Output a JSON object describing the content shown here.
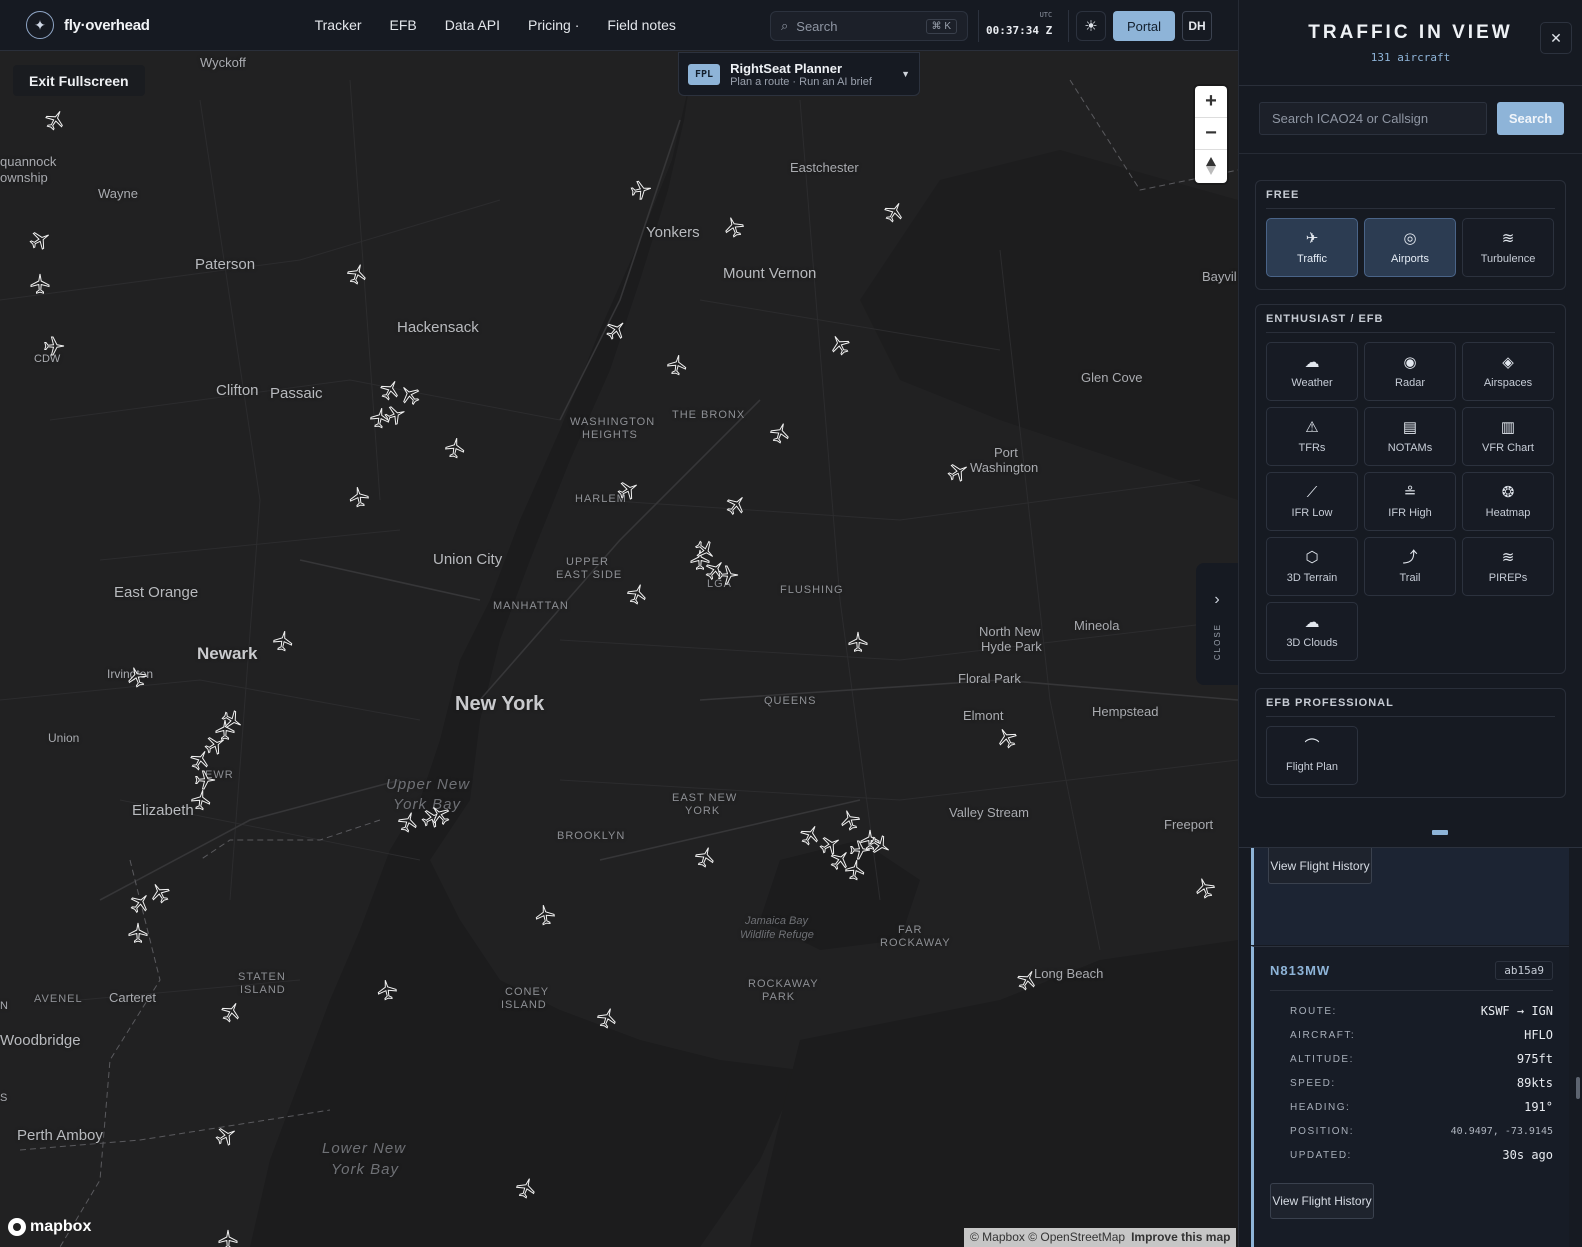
{
  "app": {
    "logo_text": "fly·overhead",
    "nav": [
      "Tracker",
      "EFB",
      "Data API",
      "Pricing ·",
      "Field notes"
    ],
    "search_placeholder": "Search",
    "search_shortcut": "⌘ K",
    "utc_label": "UTC",
    "clock": "00:37:34 Z",
    "portal_label": "Portal",
    "user_initials": "DH"
  },
  "map": {
    "exit_fullscreen": "Exit Fullscreen",
    "fpl": {
      "badge": "FPL",
      "title": "RightSeat Planner",
      "subtitle": "Plan a route · Run an AI brief"
    },
    "close_tab": "CLOSE",
    "mapbox": "mapbox",
    "attribution": "© Mapbox © OpenStreetMap",
    "improve": "Improve this map",
    "places": [
      {
        "t": "Wyckoff",
        "c": "small-plain"
      },
      {
        "t": "quannock",
        "c": "small-plain"
      },
      {
        "t": "ownship",
        "c": "small-plain"
      },
      {
        "t": "Wayne",
        "c": "small-plain"
      },
      {
        "t": "Paterson",
        "c": "mid"
      },
      {
        "t": "Hackensack",
        "c": "mid"
      },
      {
        "t": "Clifton",
        "c": "mid"
      },
      {
        "t": "Passaic",
        "c": "mid"
      },
      {
        "t": "CDW",
        "c": "small-plain"
      },
      {
        "t": "Yonkers",
        "c": "mid"
      },
      {
        "t": "Eastchester",
        "c": "small-plain"
      },
      {
        "t": "Mount Vernon",
        "c": "mid"
      },
      {
        "t": "Bayvil",
        "c": "small-plain"
      },
      {
        "t": "Glen Cove",
        "c": "small-plain"
      },
      {
        "t": "WASHINGTON",
        "c": "small"
      },
      {
        "t": "HEIGHTS",
        "c": "small"
      },
      {
        "t": "THE BRONX",
        "c": "small"
      },
      {
        "t": "Port",
        "c": "small-plain"
      },
      {
        "t": "Washington",
        "c": "small-plain"
      },
      {
        "t": "HARLEM",
        "c": "small"
      },
      {
        "t": "Union City",
        "c": "mid"
      },
      {
        "t": "UPPER",
        "c": "small"
      },
      {
        "t": "EAST SIDE",
        "c": "small"
      },
      {
        "t": "LGA",
        "c": "small"
      },
      {
        "t": "FLUSHING",
        "c": "small"
      },
      {
        "t": "East Orange",
        "c": "mid"
      },
      {
        "t": "MANHATTAN",
        "c": "small"
      },
      {
        "t": "North New",
        "c": "small-plain"
      },
      {
        "t": "Hyde Park",
        "c": "small-plain"
      },
      {
        "t": "Mineola",
        "c": "small-plain"
      },
      {
        "t": "Newark",
        "c": "big"
      },
      {
        "t": "Irvington",
        "c": "small-plain"
      },
      {
        "t": "New York",
        "c": "big"
      },
      {
        "t": "QUEENS",
        "c": "small"
      },
      {
        "t": "Floral Park",
        "c": "small-plain"
      },
      {
        "t": "Union",
        "c": "small-plain"
      },
      {
        "t": "Elmont",
        "c": "small-plain"
      },
      {
        "t": "Hempstead",
        "c": "small-plain"
      },
      {
        "t": "EWR",
        "c": "small"
      },
      {
        "t": "Upper New",
        "c": "water"
      },
      {
        "t": "York Bay",
        "c": "water"
      },
      {
        "t": "EAST NEW",
        "c": "small"
      },
      {
        "t": "YORK",
        "c": "small"
      },
      {
        "t": "Elizabeth",
        "c": "mid"
      },
      {
        "t": "BROOKLYN",
        "c": "small"
      },
      {
        "t": "Valley Stream",
        "c": "small-plain"
      },
      {
        "t": "Freeport",
        "c": "small-plain"
      },
      {
        "t": "Jamaica Bay",
        "c": "water-s"
      },
      {
        "t": "Wildlife Refuge",
        "c": "water-s"
      },
      {
        "t": "FAR",
        "c": "small"
      },
      {
        "t": "ROCKAWAY",
        "c": "small"
      },
      {
        "t": "STATEN",
        "c": "small"
      },
      {
        "t": "ISLAND",
        "c": "small"
      },
      {
        "t": "Long Beach",
        "c": "small-plain"
      },
      {
        "t": "AVENEL",
        "c": "small"
      },
      {
        "t": "Carteret",
        "c": "small-plain"
      },
      {
        "t": "ROCKAWAY",
        "c": "small"
      },
      {
        "t": "PARK",
        "c": "small"
      },
      {
        "t": "CONEY",
        "c": "small"
      },
      {
        "t": "ISLAND",
        "c": "small"
      },
      {
        "t": "Woodbridge",
        "c": "mid"
      },
      {
        "t": "Perth Amboy",
        "c": "mid"
      },
      {
        "t": "Lower New",
        "c": "water"
      },
      {
        "t": "York Bay",
        "c": "water"
      },
      {
        "t": "N",
        "c": "small-plain"
      },
      {
        "t": "S",
        "c": "small-plain"
      }
    ]
  },
  "panel": {
    "title": "TRAFFIC IN VIEW",
    "subtitle": "131 aircraft",
    "search_placeholder": "Search ICAO24 or Callsign",
    "search_button": "Search",
    "groups": [
      {
        "title": "FREE",
        "tiles": [
          {
            "label": "Traffic",
            "icon": "plane-icon",
            "active": true
          },
          {
            "label": "Airports",
            "icon": "target-icon",
            "active": true
          },
          {
            "label": "Turbulence",
            "icon": "waves-icon",
            "active": false
          }
        ]
      },
      {
        "title": "ENTHUSIAST / EFB",
        "tiles": [
          {
            "label": "Weather",
            "icon": "cloud-icon",
            "active": false
          },
          {
            "label": "Radar",
            "icon": "radar-icon",
            "active": false
          },
          {
            "label": "Airspaces",
            "icon": "layers-icon",
            "active": false
          },
          {
            "label": "TFRs",
            "icon": "warning-icon",
            "active": false
          },
          {
            "label": "NOTAMs",
            "icon": "document-icon",
            "active": false
          },
          {
            "label": "VFR Chart",
            "icon": "map-icon",
            "active": false
          },
          {
            "label": "IFR Low",
            "icon": "ifr-low-icon",
            "active": false
          },
          {
            "label": "IFR High",
            "icon": "ifr-high-icon",
            "active": false
          },
          {
            "label": "Heatmap",
            "icon": "heatmap-icon",
            "active": false
          },
          {
            "label": "3D Terrain",
            "icon": "cube-icon",
            "active": false
          },
          {
            "label": "Trail",
            "icon": "trail-icon",
            "active": false
          },
          {
            "label": "PIREPs",
            "icon": "pireps-icon",
            "active": false
          },
          {
            "label": "3D Clouds",
            "icon": "cloud3d-icon",
            "active": false
          }
        ]
      },
      {
        "title": "EFB PROFESSIONAL",
        "tiles": [
          {
            "label": "Flight Plan",
            "icon": "route-icon",
            "active": false
          }
        ]
      }
    ],
    "prev_card": {
      "button": "View Flight History"
    },
    "flight": {
      "callsign": "N813MW",
      "icao": "ab15a9",
      "rows": [
        {
          "k": "ROUTE:",
          "v": "KSWF → IGN"
        },
        {
          "k": "AIRCRAFT:",
          "v": "HFLO"
        },
        {
          "k": "ALTITUDE:",
          "v": "975ft"
        },
        {
          "k": "SPEED:",
          "v": "89kts"
        },
        {
          "k": "HEADING:",
          "v": "191°"
        },
        {
          "k": "POSITION:",
          "v": "40.9497, -73.9145"
        },
        {
          "k": "UPDATED:",
          "v": "30s ago"
        }
      ],
      "button": "View Flight History"
    },
    "accent": "#8eb4d8"
  }
}
